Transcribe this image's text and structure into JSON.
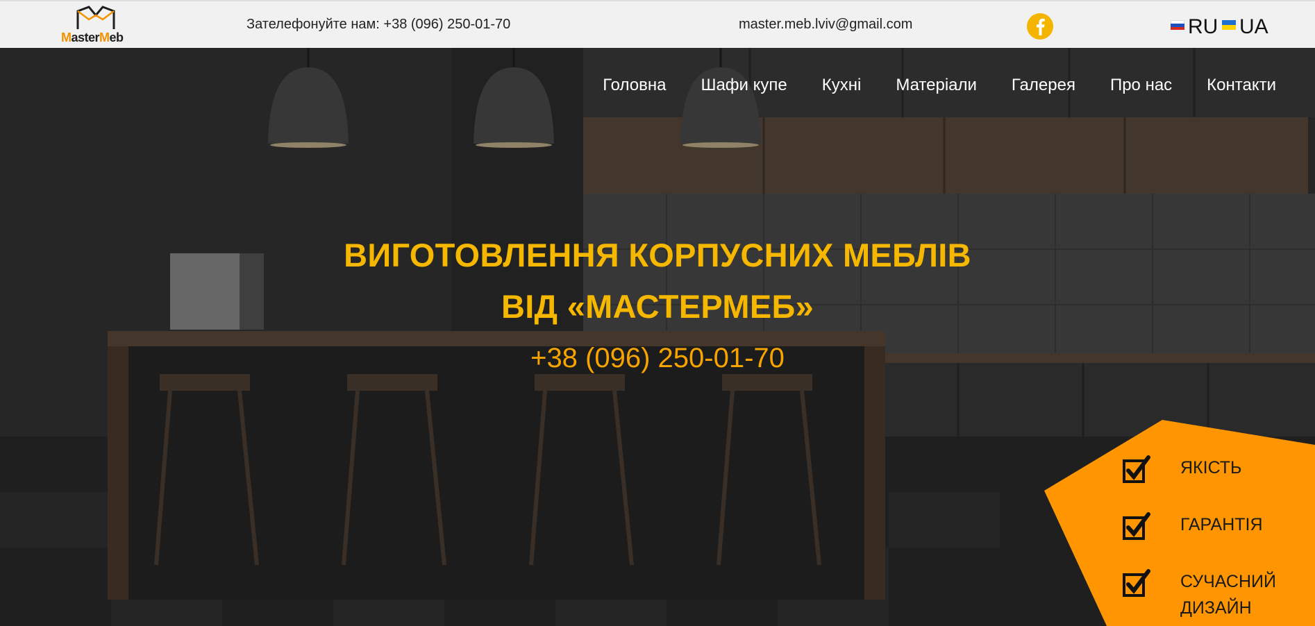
{
  "brand": {
    "logo_prefix": "M",
    "logo_middle": "aster",
    "logo_m2": "M",
    "logo_suffix": "eb"
  },
  "topbar": {
    "phone": "Зателефонуйте нам: +38 (096) 250-01-70",
    "email": "master.meb.lviv@gmail.com",
    "social_icon": "facebook-icon",
    "languages": [
      {
        "label": "RU",
        "flag": "ru-flag"
      },
      {
        "label": "UA",
        "flag": "ua-flag"
      }
    ]
  },
  "nav": {
    "items": [
      "Головна",
      "Шафи купе",
      "Кухні",
      "Матеріали",
      "Галерея",
      "Про нас",
      "Контакти"
    ]
  },
  "hero": {
    "title_line1": "ВИГОТОВЛЕННЯ КОРПУСНИХ МЕБЛІВ",
    "title_line2": "ВІД «МАСТЕРМЕБ»",
    "phone": "+38 (096) 250-01-70"
  },
  "features": {
    "items": [
      "ЯКІСТЬ",
      "ГАРАНТІЯ",
      "СУЧАСНИЙ ДИЗАЙН"
    ],
    "icon": "checkbox-check-icon"
  },
  "colors": {
    "accent": "#f5b700",
    "orange": "#ff9500",
    "topbar": "#f1f1f1"
  }
}
